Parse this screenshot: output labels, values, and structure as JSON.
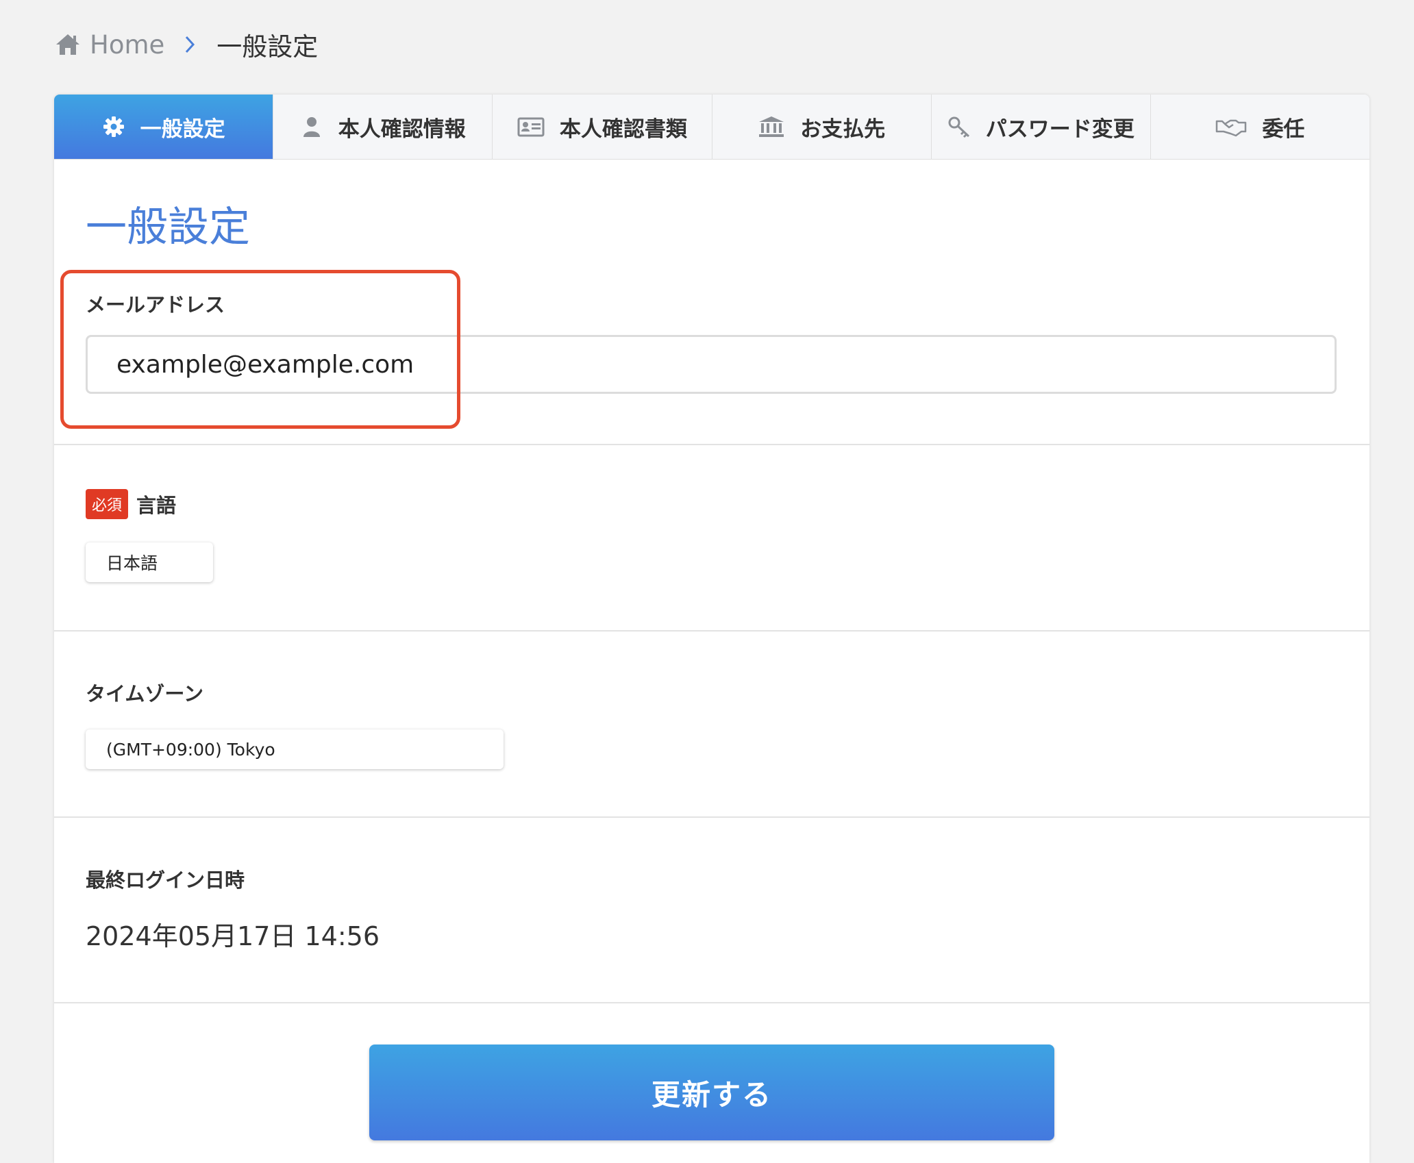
{
  "breadcrumb": {
    "home_icon": "home-icon",
    "home_label": "Home",
    "separator_icon": "chevron-right-icon",
    "current": "一般設定"
  },
  "tabs": [
    {
      "label": "一般設定",
      "icon": "gear-icon",
      "active": true
    },
    {
      "label": "本人確認情報",
      "icon": "user-icon",
      "active": false
    },
    {
      "label": "本人確認書類",
      "icon": "id-card-icon",
      "active": false
    },
    {
      "label": "お支払先",
      "icon": "bank-icon",
      "active": false
    },
    {
      "label": "パスワード変更",
      "icon": "key-icon",
      "active": false
    },
    {
      "label": "委任",
      "icon": "handshake-icon",
      "active": false
    }
  ],
  "page_title": "一般設定",
  "email": {
    "label": "メールアドレス",
    "value": "example@example.com"
  },
  "language": {
    "required_badge": "必須",
    "label": "言語",
    "selected": "日本語"
  },
  "timezone": {
    "label": "タイムゾーン",
    "selected": "(GMT+09:00) Tokyo"
  },
  "last_login": {
    "label": "最終ログイン日時",
    "value": "2024年05月17日 14:56"
  },
  "submit_label": "更新する",
  "colors": {
    "accent": "#4479df",
    "accent_light": "#3ea3e3",
    "title": "#4a7fd9",
    "required": "#e03a24",
    "highlight": "#e54b2f"
  }
}
